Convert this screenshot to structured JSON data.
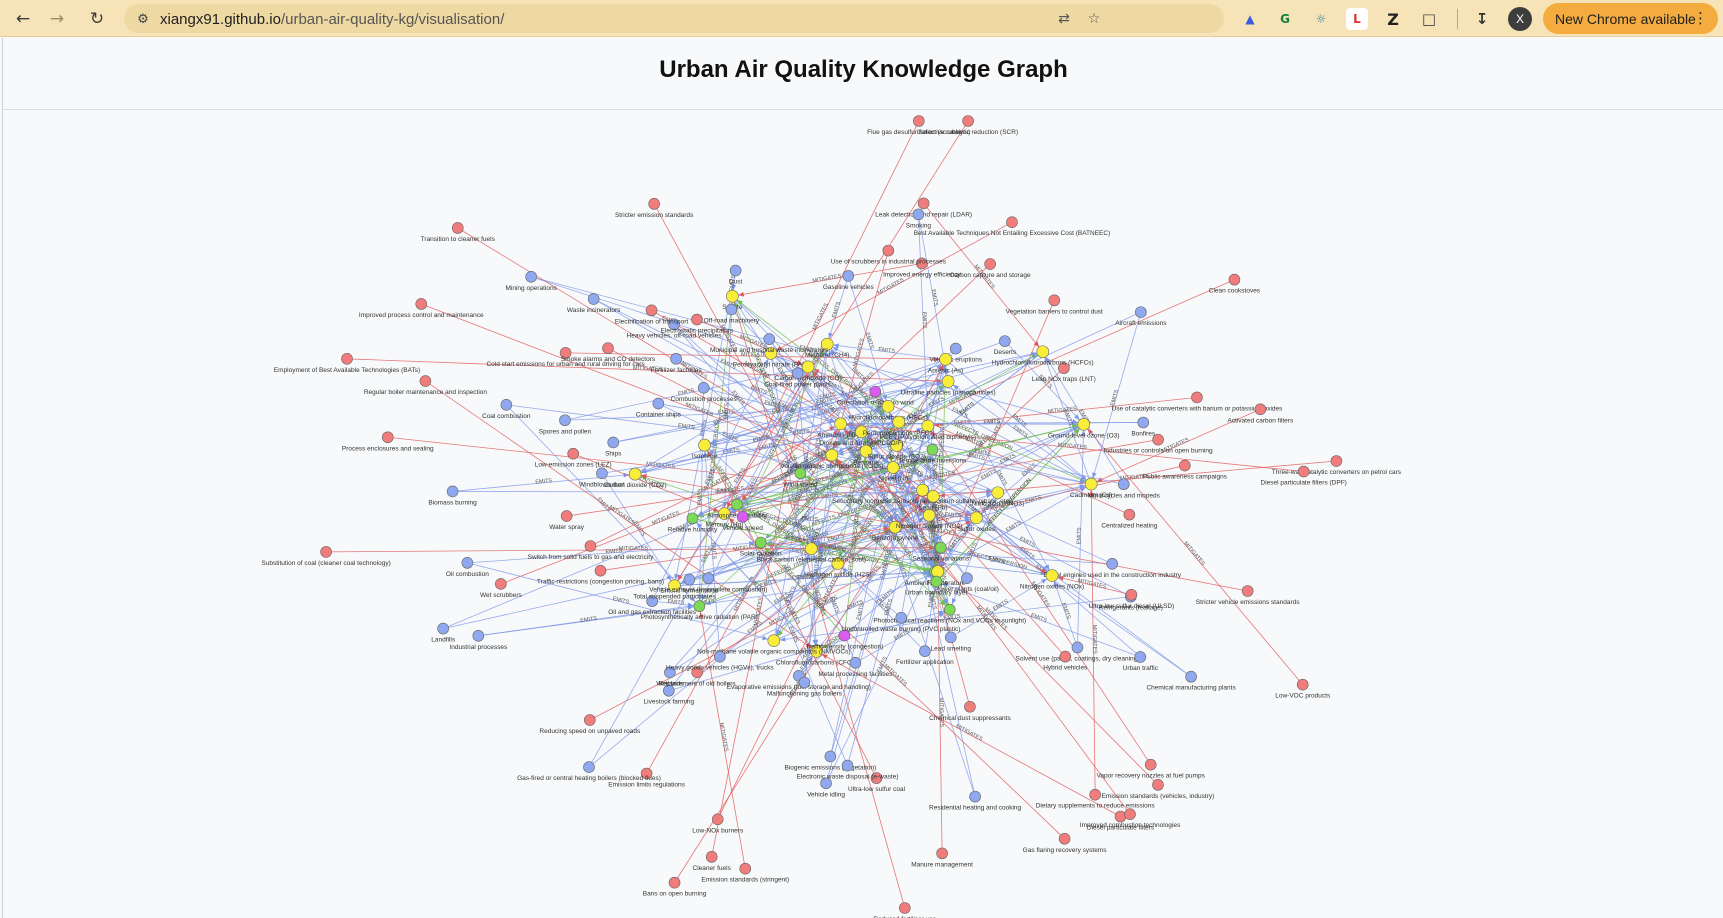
{
  "browser": {
    "url_host": "xiangx91.github.io",
    "url_path": "/urban-air-quality-kg/visualisation/",
    "update_label": "New Chrome available",
    "profile_initial": "X"
  },
  "page": {
    "title": "Urban Air Quality Knowledge Graph"
  },
  "legend_colors": {
    "source": "#8fa8f0",
    "pollutant": "#f8ee3a",
    "mitigation": "#f07c7c",
    "factor": "#7ed957",
    "receptor": "#d95bf0"
  },
  "graph": {
    "nodes": [
      {
        "label": "Low-VOC products",
        "type": "mitigation"
      },
      {
        "label": "Chemical manufacturing plants",
        "type": "source"
      },
      {
        "label": "Solvent use (paints, coatings, dry cleaning)",
        "type": "source"
      },
      {
        "label": "Refrigerants (leakage)",
        "type": "source"
      },
      {
        "label": "Dietary supplements to reduce emissions",
        "type": "mitigation"
      },
      {
        "label": "Vapor recovery nozzles at fuel pumps",
        "type": "mitigation"
      },
      {
        "label": "Manure management",
        "type": "mitigation"
      },
      {
        "label": "Reduced fertiliser use",
        "type": "mitigation"
      },
      {
        "label": "Chemical dust suppressants",
        "type": "mitigation"
      },
      {
        "label": "Chlorofluorocarbons (CFCs)",
        "type": "pollutant"
      },
      {
        "label": "Hydrogen sulfide (H2S)",
        "type": "pollutant"
      },
      {
        "label": "Evaporative emissions (fuel storage and handling)",
        "type": "source"
      },
      {
        "label": "Biogenic emissions (vegetation)",
        "type": "source"
      },
      {
        "label": "Livestock farming",
        "type": "source"
      },
      {
        "label": "Reducing speed on unpaved roads",
        "type": "mitigation"
      },
      {
        "label": "Enteric fermentation",
        "type": "source"
      },
      {
        "label": "Wetlands",
        "type": "source"
      },
      {
        "label": "Photosynthetically active radiation (PAR)",
        "type": "factor"
      },
      {
        "label": "Wet scrubbers",
        "type": "mitigation"
      },
      {
        "label": "Oil and gas extraction facilities",
        "type": "source"
      },
      {
        "label": "Landfills",
        "type": "source"
      },
      {
        "label": "Process enclosures and sealing",
        "type": "mitigation"
      },
      {
        "label": "Windblown dust",
        "type": "source"
      },
      {
        "label": "Water spray",
        "type": "mitigation"
      },
      {
        "label": "Isoprene",
        "type": "pollutant"
      },
      {
        "label": "Employment of Best Available Technologies (BATs)",
        "type": "mitigation"
      },
      {
        "label": "Spores and pollen",
        "type": "source"
      },
      {
        "label": "Mining operations",
        "type": "source"
      },
      {
        "label": "Fertilizer factories",
        "type": "source"
      },
      {
        "label": "Stricter emission standards",
        "type": "mitigation"
      },
      {
        "label": "Dust",
        "type": "source"
      },
      {
        "label": "Sulfate",
        "type": "pollutant"
      },
      {
        "label": "Peroxyacetyl nitrate (PAN)",
        "type": "pollutant"
      },
      {
        "label": "Methane (CH4)",
        "type": "pollutant"
      },
      {
        "label": "Ammonia (NH3)",
        "type": "pollutant"
      },
      {
        "label": "Volatile organic compounds (VOCs)",
        "type": "pollutant"
      },
      {
        "label": "Leak detection and repair (LDAR)",
        "type": "mitigation"
      },
      {
        "label": "Vegetation barriers to control dust",
        "type": "mitigation"
      },
      {
        "label": "Benzene",
        "type": "pollutant"
      },
      {
        "label": "Deserts",
        "type": "source"
      },
      {
        "label": "Ultrafine particles (nanoparticles)",
        "type": "pollutant"
      },
      {
        "label": "Lean NOx traps (LNT)",
        "type": "mitigation"
      },
      {
        "label": "Clean cookstoves",
        "type": "mitigation"
      },
      {
        "label": "Use of catalytic converters with barium or potassium oxides",
        "type": "mitigation"
      },
      {
        "label": "Nitric acid (HNO3)",
        "type": "pollutant"
      },
      {
        "label": "Ground-level ozone (O3)",
        "type": "pollutant"
      },
      {
        "label": "Secondary inorganic aerosols (ammonium sulfate, nitrate, etc.)",
        "type": "pollutant"
      },
      {
        "label": "Diesel engines used in the construction industry",
        "type": "source"
      },
      {
        "label": "Centralized heating",
        "type": "mitigation"
      },
      {
        "label": "Benzo(a)pyrene",
        "type": "pollutant"
      },
      {
        "label": "Seasonal variations",
        "type": "factor"
      },
      {
        "label": "Photochemical reactions (NOx and VOCs in sunlight)",
        "type": "factor"
      },
      {
        "label": "Ambient temperature",
        "type": "factor"
      },
      {
        "label": "Diesel particulate filters",
        "type": "mitigation"
      },
      {
        "label": "Fertilizer application",
        "type": "source"
      },
      {
        "label": "Residential heating and cooking",
        "type": "source"
      },
      {
        "label": "Gas flaring recovery systems",
        "type": "mitigation"
      },
      {
        "label": "Vehicle idling",
        "type": "source"
      },
      {
        "label": "Traffic density (congestion)",
        "type": "receptor"
      },
      {
        "label": "Emission standards (stringent)",
        "type": "mitigation"
      },
      {
        "label": "Cleaner fuels",
        "type": "mitigation"
      },
      {
        "label": "Non-methane volatile organic compounds (NMVOCs)",
        "type": "pollutant"
      },
      {
        "label": "Black carbon (elemental carbon, soot)",
        "type": "pollutant"
      },
      {
        "label": "Emission limits regulations",
        "type": "mitigation"
      },
      {
        "label": "Total suspended particulates",
        "type": "pollutant"
      },
      {
        "label": "Vehicle exhaust (incomplete combustion)",
        "type": "source"
      },
      {
        "label": "Solar radiation",
        "type": "factor"
      },
      {
        "label": "Substitution of coal (cleaner coal technology)",
        "type": "mitigation"
      },
      {
        "label": "Switch from solid fuels to gas and electricity",
        "type": "mitigation"
      },
      {
        "label": "Carbon dioxide (CO2)",
        "type": "pollutant"
      },
      {
        "label": "Relative humidity",
        "type": "factor"
      },
      {
        "label": "Ships",
        "type": "source"
      },
      {
        "label": "Coal combustion",
        "type": "source"
      },
      {
        "label": "Cold start emissions for urban and rural driving for cars",
        "type": "mitigation"
      },
      {
        "label": "Container ships",
        "type": "source"
      },
      {
        "label": "Transition to cleaner fuels",
        "type": "mitigation"
      },
      {
        "label": "Wind speed",
        "type": "factor"
      },
      {
        "label": "Combustion processes",
        "type": "source"
      },
      {
        "label": "Heavy vehicles, off-road vehicles",
        "type": "source"
      },
      {
        "label": "Carbon monoxide (CO)",
        "type": "pollutant"
      },
      {
        "label": "Off-road machinery",
        "type": "source"
      },
      {
        "label": "Flue gas desulfurization (scrubbers)",
        "type": "mitigation"
      },
      {
        "label": "Smoking",
        "type": "source"
      },
      {
        "label": "Orientation relative to wind",
        "type": "receptor"
      },
      {
        "label": "Volcanic eruptions",
        "type": "source"
      },
      {
        "label": "Carbon capture and storage",
        "type": "mitigation"
      },
      {
        "label": "Improved energy efficiency",
        "type": "mitigation"
      },
      {
        "label": "Sulfur dioxide (SO2)",
        "type": "pollutant"
      },
      {
        "label": "PCBs (Polychlorinated biphenyls)",
        "type": "pollutant"
      },
      {
        "label": "Temperature inversions",
        "type": "factor"
      },
      {
        "label": "Aircraft emissions",
        "type": "source"
      },
      {
        "label": "Industries or controls on open burning",
        "type": "mitigation"
      },
      {
        "label": "Public awareness campaigns",
        "type": "mitigation"
      },
      {
        "label": "Bonfires",
        "type": "source"
      },
      {
        "label": "Sulfur oxides",
        "type": "pollutant"
      },
      {
        "label": "Nitrogen dioxide (NO2)",
        "type": "pollutant"
      },
      {
        "label": "Nitrogen oxides (NOx)",
        "type": "pollutant"
      },
      {
        "label": "Power plants (coal/oil)",
        "type": "source"
      },
      {
        "label": "Furans",
        "type": "pollutant"
      },
      {
        "label": "Urban traffic",
        "type": "source"
      },
      {
        "label": "Urban boundary layer",
        "type": "factor"
      },
      {
        "label": "Lead smelting",
        "type": "source"
      },
      {
        "label": "Improved combustion technologies",
        "type": "mitigation"
      },
      {
        "label": "Ultra-low sulfur coal",
        "type": "mitigation"
      },
      {
        "label": "Uncontrolled waste burning (PVC plastic)",
        "type": "source"
      },
      {
        "label": "Malfunctioning gas boilers",
        "type": "source"
      },
      {
        "label": "Electronic waste disposal (e-waste)",
        "type": "source"
      },
      {
        "label": "Metal processing facilities",
        "type": "source"
      },
      {
        "label": "Low-NOx burners",
        "type": "mitigation"
      },
      {
        "label": "Bans on open burning",
        "type": "mitigation"
      },
      {
        "label": "Replacement of old boilers",
        "type": "mitigation"
      },
      {
        "label": "Gas-fired or central heating boilers (blocked flues)",
        "type": "source"
      },
      {
        "label": "Heavy goods vehicles (HGVs), trucks",
        "type": "source"
      },
      {
        "label": "Industrial processes",
        "type": "source"
      },
      {
        "label": "Oil combustion",
        "type": "source"
      },
      {
        "label": "Mercury (Hg)",
        "type": "pollutant"
      },
      {
        "label": "Traffic restrictions (congestion pricing, bans)",
        "type": "mitigation"
      },
      {
        "label": "Atmospheric stability",
        "type": "factor"
      },
      {
        "label": "Vehicle speed",
        "type": "receptor"
      },
      {
        "label": "Biomass burning",
        "type": "source"
      },
      {
        "label": "Low-emission zones (LEZ)",
        "type": "mitigation"
      },
      {
        "label": "Smoke alarms and CO detectors",
        "type": "mitigation"
      },
      {
        "label": "Regular boiler maintenance and inspection",
        "type": "mitigation"
      },
      {
        "label": "Electrification of transport",
        "type": "mitigation"
      },
      {
        "label": "Improved process control and maintenance",
        "type": "mitigation"
      },
      {
        "label": "Waste incinerators",
        "type": "source"
      },
      {
        "label": "Electrostatic precipitators",
        "type": "mitigation"
      },
      {
        "label": "Municipal and hospital waste incinerators",
        "type": "source"
      },
      {
        "label": "Gasoline vehicles",
        "type": "source"
      },
      {
        "label": "Coal-fired power plants",
        "type": "source"
      },
      {
        "label": "Selective catalytic reduction (SCR)",
        "type": "mitigation"
      },
      {
        "label": "Use of scrubbers in industrial processes",
        "type": "mitigation"
      },
      {
        "label": "Best Available Techniques Not Entailing Excessive Cost (BATNEEC)",
        "type": "mitigation"
      },
      {
        "label": "Dioxins and furans (PCDD/F)",
        "type": "pollutant"
      },
      {
        "label": "Hydrofluorocarbons (HFCs)",
        "type": "pollutant"
      },
      {
        "label": "Arsenic (As)",
        "type": "pollutant"
      },
      {
        "label": "Perfluorocarbons (PFCs)",
        "type": "pollutant"
      },
      {
        "label": "Nickel (Ni)",
        "type": "pollutant"
      },
      {
        "label": "Hydrochlorofluorocarbons (HCFCs)",
        "type": "pollutant"
      },
      {
        "label": "Activated carbon filters",
        "type": "mitigation"
      },
      {
        "label": "Three-way catalytic converters on petrol cars",
        "type": "mitigation"
      },
      {
        "label": "Diesel particulate filters (DPF)",
        "type": "mitigation"
      },
      {
        "label": "Motorcycles and mopeds",
        "type": "source"
      },
      {
        "label": "Cadmium (Cd)",
        "type": "pollutant"
      },
      {
        "label": "Lead (Pb)",
        "type": "pollutant"
      },
      {
        "label": "Ultra-low sulfur diesel (ULSD)",
        "type": "mitigation"
      },
      {
        "label": "Stricter vehicle emissions standards",
        "type": "mitigation"
      },
      {
        "label": "Emission standards (vehicles, industry)",
        "type": "mitigation"
      },
      {
        "label": "Hybrid vehicles",
        "type": "mitigation"
      }
    ],
    "edge_labels": [
      "EMITS",
      "MITIGATES",
      "AFFECTS_DISPERSION"
    ]
  }
}
